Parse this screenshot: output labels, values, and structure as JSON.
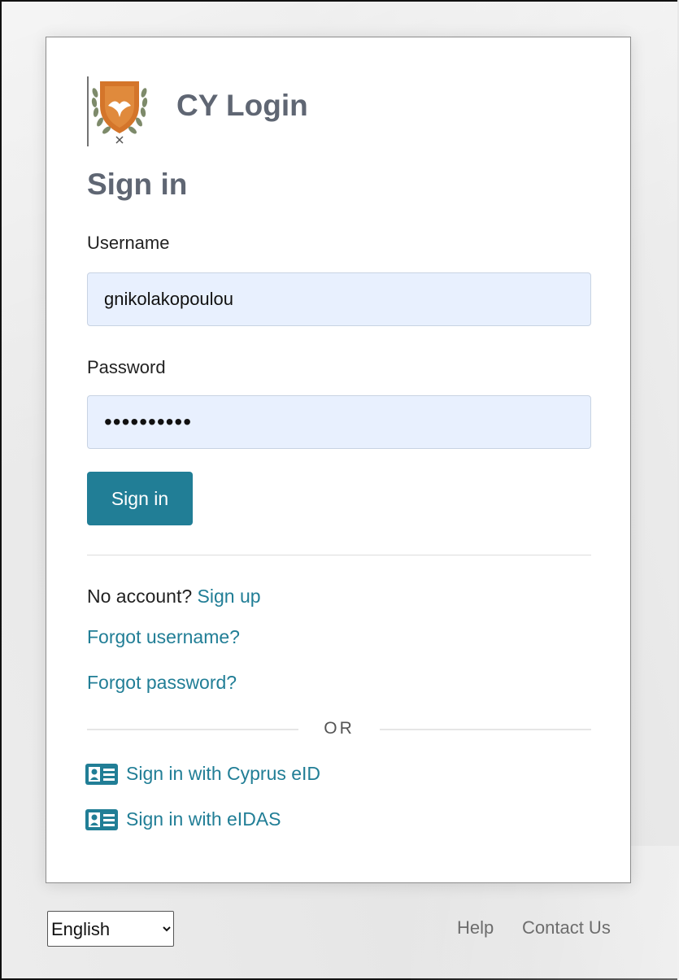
{
  "brand": {
    "title": "CY Login",
    "logo": "cyprus-coat-of-arms"
  },
  "form": {
    "heading": "Sign in",
    "username_label": "Username",
    "username_value": "gnikolakopoulou",
    "password_label": "Password",
    "password_value": "••••••••••",
    "submit_label": "Sign in"
  },
  "links": {
    "no_account_text": "No account?",
    "sign_up": "Sign up",
    "forgot_username": "Forgot username?",
    "forgot_password": "Forgot password?",
    "or_separator": "OR",
    "eid_cyprus": "Sign in with Cyprus eID",
    "eid_eidas": "Sign in with eIDAS",
    "eid_icon": "id-card-icon"
  },
  "footer": {
    "language_selected": "English",
    "help": "Help",
    "contact": "Contact Us"
  },
  "colors": {
    "accent": "#217e96",
    "heading": "#5f6673",
    "input_bg": "#e8f0fe",
    "crest": "#d4752a"
  }
}
